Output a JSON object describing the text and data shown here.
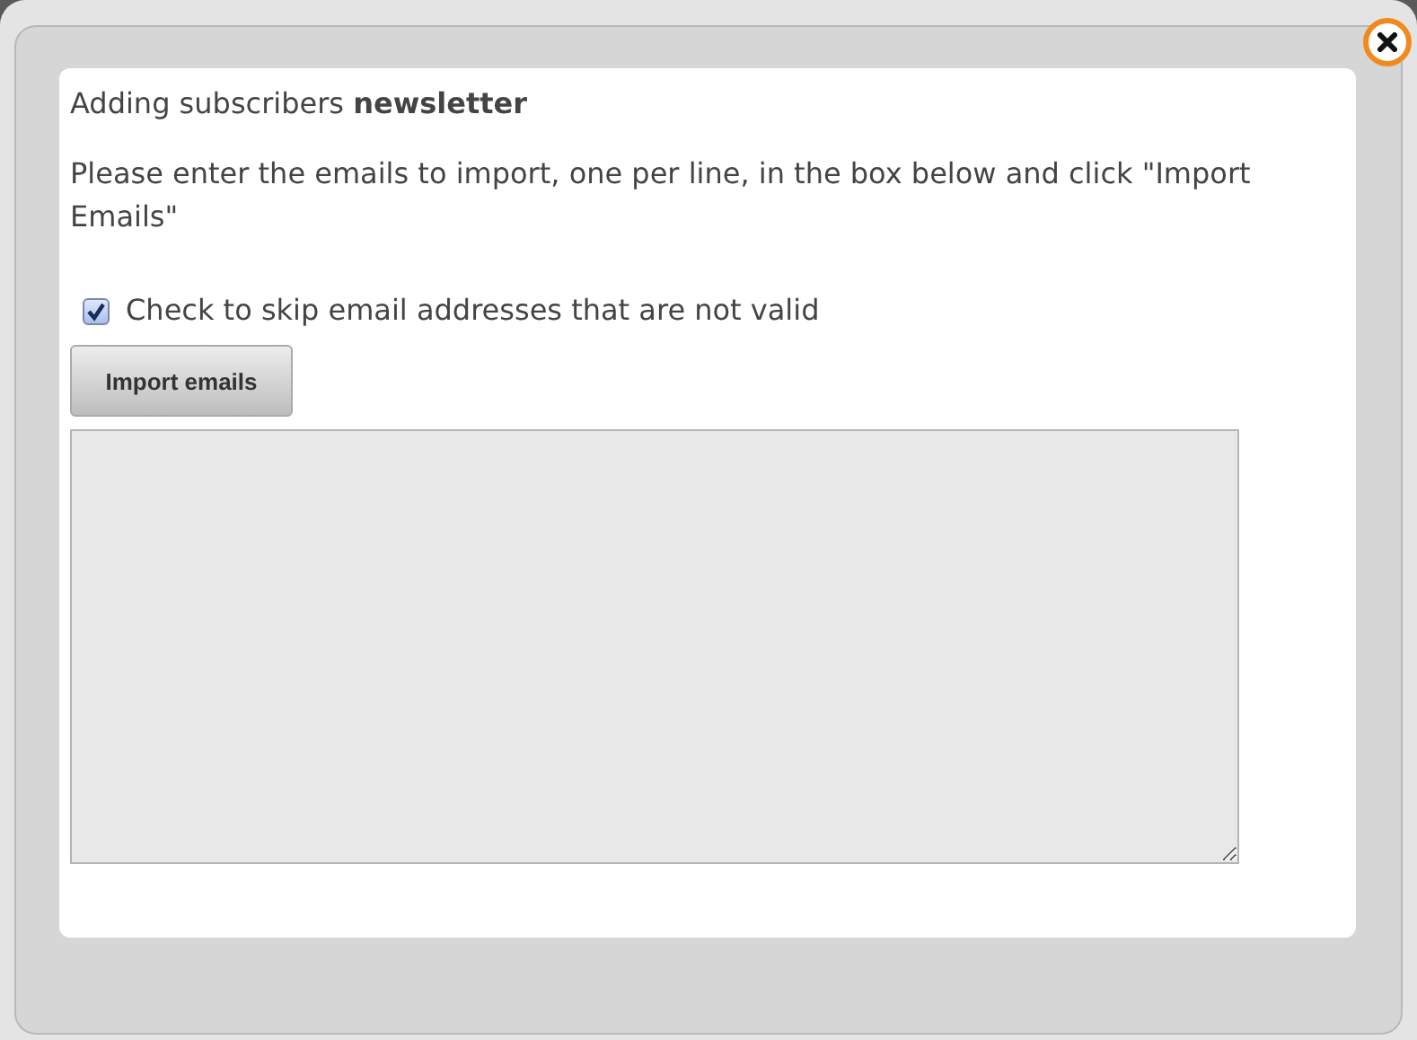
{
  "dialog": {
    "heading": "Adding subscribers **newsletter**",
    "instructions": "Please enter the emails to import, one per line, in the box below and click \"Import Emails\"",
    "skip_invalid": {
      "label": "Check to skip email addresses that are not valid",
      "checked": true
    },
    "import_button": "Import emails"
  }
}
